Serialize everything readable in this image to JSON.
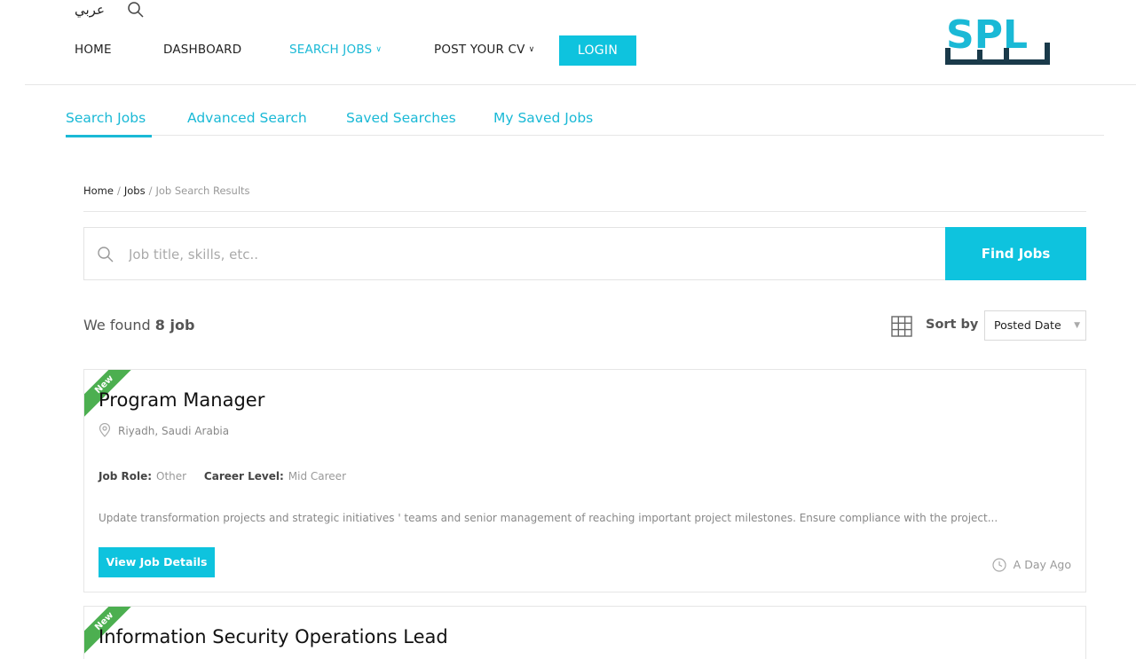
{
  "header": {
    "language_link": "عربي",
    "nav": [
      {
        "label": "HOME",
        "has_dropdown": false,
        "active": false
      },
      {
        "label": "DASHBOARD",
        "has_dropdown": false,
        "active": false
      },
      {
        "label": "SEARCH JOBS",
        "has_dropdown": true,
        "active": true
      },
      {
        "label": "POST YOUR CV",
        "has_dropdown": true,
        "active": false
      }
    ],
    "login_label": "LOGIN",
    "logo_text": "SPL"
  },
  "subnav": {
    "items": [
      "Search Jobs",
      "Advanced Search",
      "Saved Searches",
      "My Saved Jobs"
    ],
    "active": "Search Jobs"
  },
  "breadcrumb": {
    "home": "Home",
    "jobs": "Jobs",
    "current": "Job Search Results",
    "sep": "/"
  },
  "search": {
    "placeholder": "Job title, skills, etc..",
    "value": "",
    "button_label": "Find Jobs"
  },
  "results": {
    "found_prefix": "We found",
    "found_count": "8 job",
    "sort_label": "Sort by",
    "sort_value": "Posted Date"
  },
  "jobs": [
    {
      "badge": "New",
      "title": "Program Manager",
      "location": "Riyadh, Saudi Arabia",
      "role_label": "Job Role:",
      "role": "Other",
      "level_label": "Career Level:",
      "level": "Mid Career",
      "description": "Update transformation projects and strategic initiatives ' teams and senior management of reaching important project milestones. Ensure compliance with the project...",
      "button_label": "View Job Details",
      "posted": "A Day Ago"
    },
    {
      "badge": "New",
      "title": "Information Security Operations Lead"
    }
  ],
  "colors": {
    "accent": "#0ec3de",
    "link": "#1ab9d6",
    "badge": "#4caf50"
  }
}
